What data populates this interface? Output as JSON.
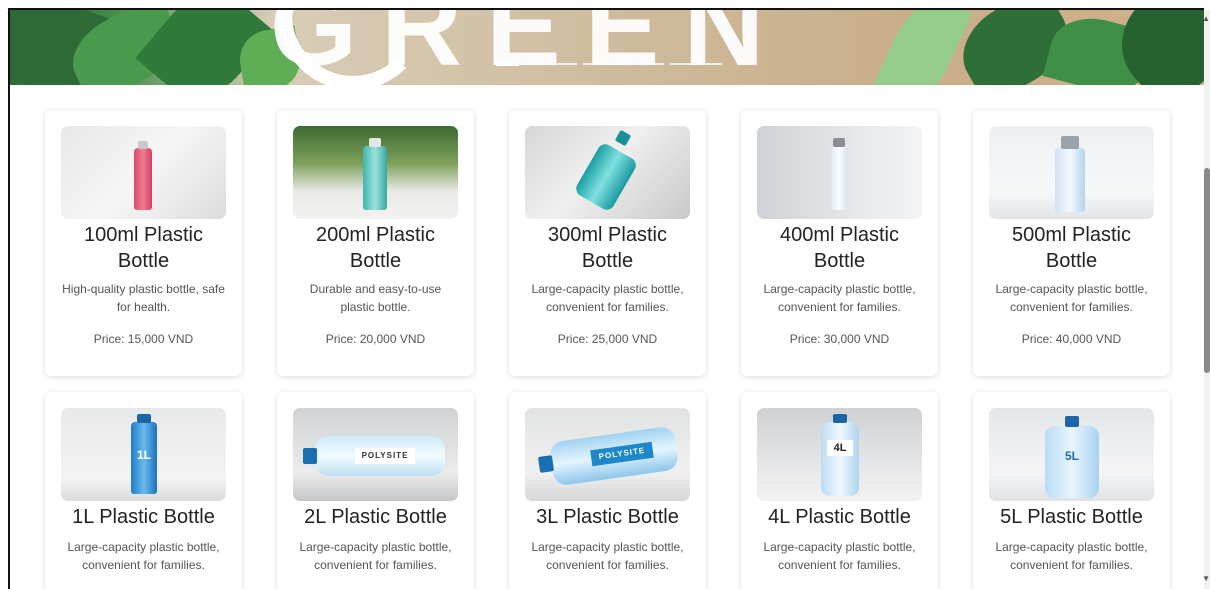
{
  "hero": {
    "text": "GREEN",
    "slides": 8,
    "active_slide": 1
  },
  "colors": {
    "card_bg": "#ffffff",
    "text": "#222222",
    "muted": "#555555",
    "leaf_green": "#3f8a46"
  },
  "products": [
    {
      "title": "100ml Plastic Bottle",
      "desc": "High-quality plastic bottle, safe for health.",
      "price": "Price: 15,000 VND"
    },
    {
      "title": "200ml Plastic Bottle",
      "desc": "Durable and easy-to-use plastic bottle.",
      "price": "Price: 20,000 VND"
    },
    {
      "title": "300ml Plastic Bottle",
      "desc": "Large-capacity plastic bottle, convenient for families.",
      "price": "Price: 25,000 VND"
    },
    {
      "title": "400ml Plastic Bottle",
      "desc": "Large-capacity plastic bottle, convenient for families.",
      "price": "Price: 30,000 VND"
    },
    {
      "title": "500ml Plastic Bottle",
      "desc": "Large-capacity plastic bottle, convenient for families.",
      "price": "Price: 40,000 VND"
    },
    {
      "title": "1L Plastic Bottle",
      "desc": "Large-capacity plastic bottle, convenient for families.",
      "label": "1L"
    },
    {
      "title": "2L Plastic Bottle",
      "desc": "Large-capacity plastic bottle, convenient for families.",
      "label": "POLYSITE"
    },
    {
      "title": "3L Plastic Bottle",
      "desc": "Large-capacity plastic bottle, convenient for families.",
      "label": "POLYSITE"
    },
    {
      "title": "4L Plastic Bottle",
      "desc": "Large-capacity plastic bottle, convenient for families.",
      "label": "4L"
    },
    {
      "title": "5L Plastic Bottle",
      "desc": "Large-capacity plastic bottle, convenient for families.",
      "label": "5L"
    }
  ]
}
